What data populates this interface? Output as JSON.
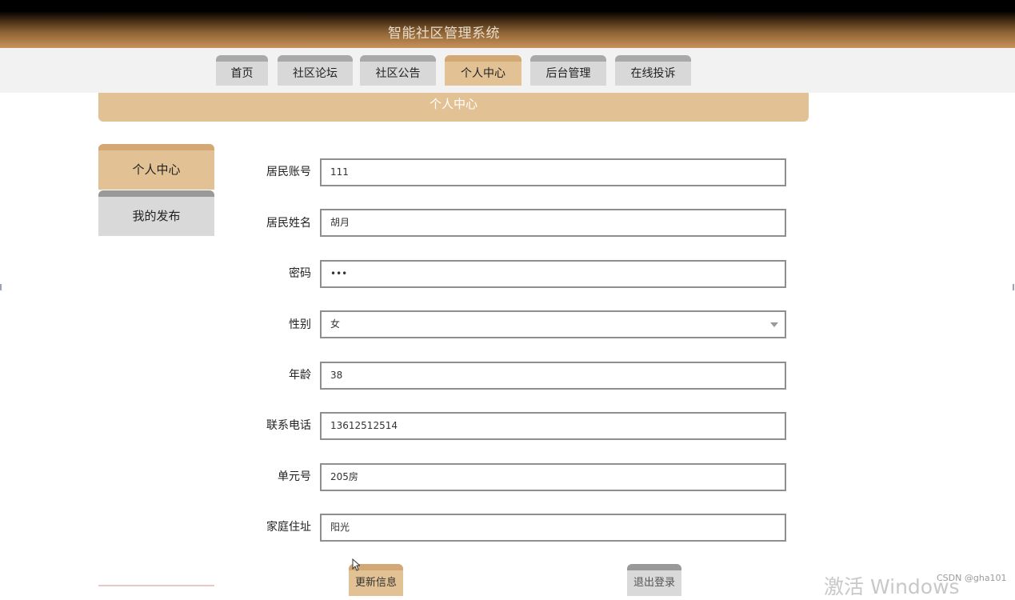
{
  "app": {
    "title": "智能社区管理系统"
  },
  "nav": {
    "tabs": [
      {
        "label": "首页",
        "active": false
      },
      {
        "label": "社区论坛",
        "active": false
      },
      {
        "label": "社区公告",
        "active": false
      },
      {
        "label": "个人中心",
        "active": true
      },
      {
        "label": "后台管理",
        "active": false
      },
      {
        "label": "在线投诉",
        "active": false
      }
    ]
  },
  "section": {
    "title": "个人中心"
  },
  "sidebar": {
    "items": [
      {
        "label": "个人中心",
        "active": true
      },
      {
        "label": "我的发布",
        "active": false
      }
    ]
  },
  "form": {
    "account": {
      "label": "居民账号",
      "value": "111"
    },
    "name": {
      "label": "居民姓名",
      "value": "胡月"
    },
    "password": {
      "label": "密码",
      "value": "•••"
    },
    "gender": {
      "label": "性别",
      "value": "女"
    },
    "age": {
      "label": "年龄",
      "value": "38"
    },
    "phone": {
      "label": "联系电话",
      "value": "13612512514"
    },
    "unit": {
      "label": "单元号",
      "value": "205房"
    },
    "address": {
      "label": "家庭住址",
      "value": "阳光"
    }
  },
  "actions": {
    "update_label": "更新信息",
    "logout_label": "退出登录"
  },
  "overlay": {
    "watermark": "激活 Windows",
    "credit": "CSDN @gha101"
  },
  "colors": {
    "accent": "#e2c294",
    "accent_dark": "#d4a874",
    "header_gradient_end": "#c8935a"
  }
}
